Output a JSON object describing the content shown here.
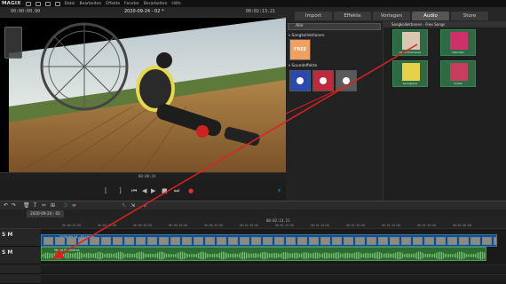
{
  "app": {
    "brand": "MAGIX"
  },
  "menu": [
    "Datei",
    "Bearbeiten",
    "Effekte",
    "Fenster",
    "Berarbeiten",
    "Hilfe"
  ],
  "preview_bar": {
    "timecode_left": "00:00:00.00",
    "project_title": "2020-09-24 - 02 *",
    "timecode_right": "00:02:13.21"
  },
  "tabs": [
    {
      "label": "Import",
      "active": false
    },
    {
      "label": "Effekte",
      "active": false
    },
    {
      "label": "Vorlagen",
      "active": false
    },
    {
      "label": "Audio",
      "active": true
    },
    {
      "label": "Store",
      "active": false
    }
  ],
  "mediapool": {
    "filter_value": "Alle",
    "section_song_collections": "Songkollektionen",
    "free_tile_label": "FREE",
    "section_sound_effects": "Soundeffekte",
    "right_header": "Songkollektionen - Free Songs",
    "albums": [
      {
        "caption": "World Premieres",
        "color": "#d9c7b0"
      },
      {
        "caption": "Hellroller",
        "color": "#d0306a"
      },
      {
        "caption": "Springtime",
        "color": "#e6d24a"
      },
      {
        "caption": "Suede",
        "color": "#c83c60"
      }
    ]
  },
  "preview_ruler": {
    "timecode": "00:00:24"
  },
  "transport": {
    "buttons": [
      "[",
      "]",
      "⏮",
      "◀",
      "▶",
      "■",
      "⏭",
      "●",
      "⚡"
    ]
  },
  "timeline": {
    "tab_label": "2020-09-24 - 02",
    "cursor_timecode": "00:02:13.21",
    "ruler_ticks": [
      "00:00:10:00",
      "00:00:20:00",
      "00:00:30:00",
      "00:00:40:00",
      "00:00:50:00",
      "00:01:00:00",
      "00:01:10:00",
      "00:01:20:00",
      "00:01:30:00",
      "00:01:40:00",
      "00:01:50:00",
      "00:02:00:00"
    ],
    "track1_letters": "S M",
    "track2_letters": "S M",
    "audio_clip_label": "World Premieres",
    "video_clip_label": "2020-09-24 - 02 Video"
  },
  "colors": {
    "arrow": "#e02020",
    "accent": "#3a9be0",
    "audio_clip": "#2e6b30",
    "video_clip": "#1e4c7a"
  }
}
